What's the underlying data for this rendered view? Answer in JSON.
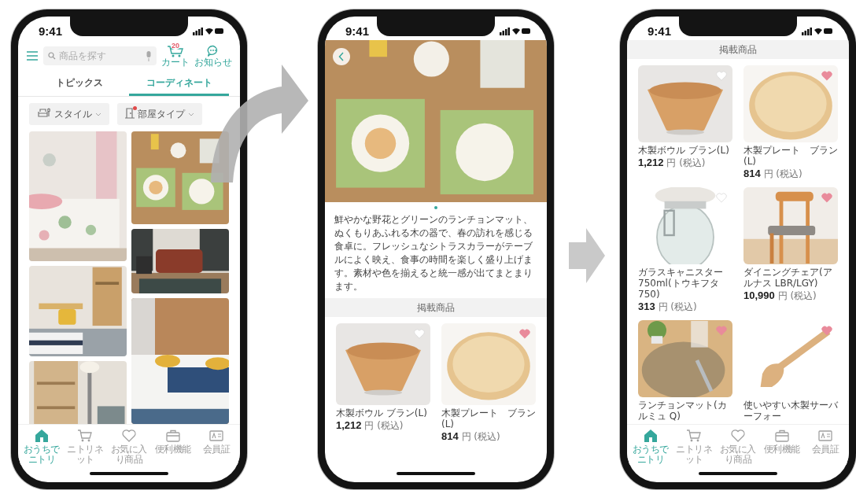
{
  "screens": [
    {
      "kind": "feed",
      "status_time": "9:41",
      "search": {
        "placeholder": "商品を探す"
      },
      "cart": {
        "count": "20",
        "label": "カート"
      },
      "notice": {
        "label": "お知らせ"
      },
      "tabs": [
        {
          "label": "トピックス",
          "selected": false
        },
        {
          "label": "コーディネート",
          "selected": true
        }
      ],
      "filters": [
        {
          "label": "スタイル",
          "dot": false
        },
        {
          "label": "部屋タイプ",
          "dot": true
        }
      ],
      "bottom_nav": [
        {
          "label": "おうちでニトリ",
          "selected": true
        },
        {
          "label": "ニトリネット",
          "selected": false
        },
        {
          "label": "お気に入り商品",
          "selected": false
        },
        {
          "label": "便利機能",
          "selected": false
        },
        {
          "label": "会員証",
          "selected": false
        }
      ]
    },
    {
      "kind": "detail",
      "status_time": "9:41",
      "page_dots": [
        {
          "selected": true
        }
      ],
      "description": "鮮やかな野花とグリーンのランチョンマット、ぬくもりあふれる木の器で、春の訪れを感じる食卓に。フレッシュなシトラスカラーがテーブルによく映え、食事の時間を楽しく盛り上げます。素材や色を揃えると統一感が出てまとまります。",
      "section_title": "掲載商品",
      "products": [
        {
          "name": "木製ボウル ブラン(L)",
          "price": "1,212",
          "unit": "円",
          "tax": "(税込)",
          "favorite": false
        },
        {
          "name": "木製プレート　ブラン(L)",
          "price": "814",
          "unit": "円",
          "tax": "(税込)",
          "favorite": true
        }
      ]
    },
    {
      "kind": "products",
      "status_time": "9:41",
      "section_title": "掲載商品",
      "products": [
        {
          "name": "木製ボウル ブラン(L)",
          "price": "1,212",
          "unit": "円",
          "tax": "(税込)",
          "favorite": false
        },
        {
          "name": "木製プレート　ブラン(L)",
          "price": "814",
          "unit": "円",
          "tax": "(税込)",
          "favorite": true
        },
        {
          "name": "ガラスキャニスター750ml(トウキフタ 750)",
          "price": "313",
          "unit": "円",
          "tax": "(税込)",
          "favorite": false
        },
        {
          "name": "ダイニングチェア(アルナス LBR/LGY)",
          "price": "10,990",
          "unit": "円",
          "tax": "(税込)",
          "favorite": true
        },
        {
          "name": "ランチョンマット(カルミュ Q)",
          "favorite": true
        },
        {
          "name": "使いやすい木製サーバーフォー",
          "favorite": true
        }
      ],
      "bottom_nav": [
        {
          "label": "おうちでニトリ",
          "selected": true
        },
        {
          "label": "ニトリネット",
          "selected": false
        },
        {
          "label": "お気に入り商品",
          "selected": false
        },
        {
          "label": "便利機能",
          "selected": false
        },
        {
          "label": "会員証",
          "selected": false
        }
      ]
    }
  ]
}
